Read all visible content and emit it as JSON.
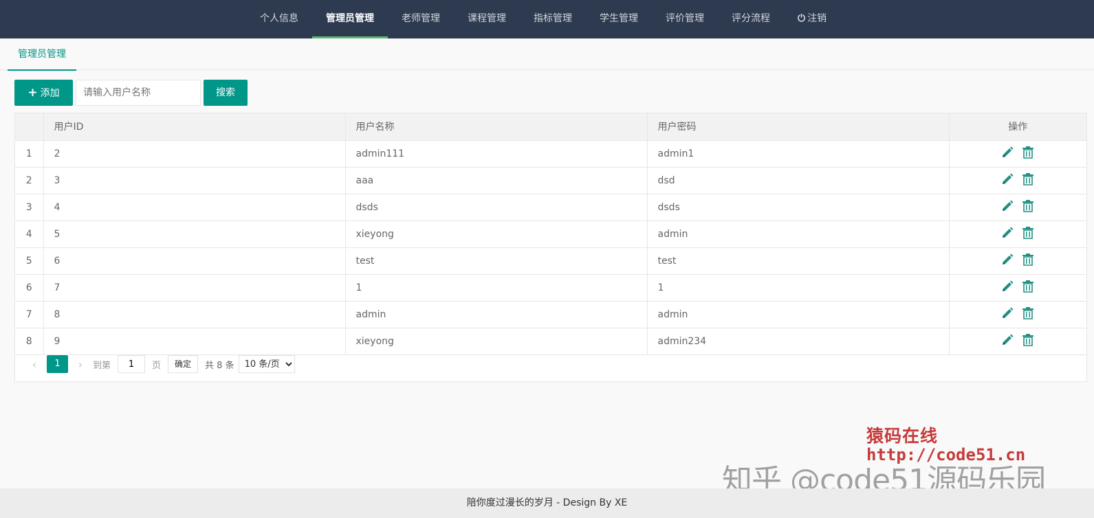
{
  "nav": {
    "items": [
      {
        "label": "个人信息",
        "active": false
      },
      {
        "label": "管理员管理",
        "active": true
      },
      {
        "label": "老师管理",
        "active": false
      },
      {
        "label": "课程管理",
        "active": false
      },
      {
        "label": "指标管理",
        "active": false
      },
      {
        "label": "学生管理",
        "active": false
      },
      {
        "label": "评价管理",
        "active": false
      },
      {
        "label": "评分流程",
        "active": false
      }
    ],
    "logout": {
      "icon": "power-icon",
      "label": "注销"
    }
  },
  "tab": {
    "label": "管理员管理"
  },
  "toolbar": {
    "add_label": "添加",
    "search_placeholder": "请输入用户名称",
    "search_value": "",
    "search_label": "搜索"
  },
  "table": {
    "columns": [
      "",
      "用户ID",
      "用户名称",
      "用户密码",
      "操作"
    ],
    "rows": [
      {
        "index": "1",
        "id": "2",
        "name": "admin111",
        "password": "admin1"
      },
      {
        "index": "2",
        "id": "3",
        "name": "aaa",
        "password": "dsd"
      },
      {
        "index": "3",
        "id": "4",
        "name": "dsds",
        "password": "dsds"
      },
      {
        "index": "4",
        "id": "5",
        "name": "xieyong",
        "password": "admin"
      },
      {
        "index": "5",
        "id": "6",
        "name": "test",
        "password": "test"
      },
      {
        "index": "6",
        "id": "7",
        "name": "1",
        "password": "1"
      },
      {
        "index": "7",
        "id": "8",
        "name": "admin",
        "password": "admin"
      },
      {
        "index": "8",
        "id": "9",
        "name": "xieyong",
        "password": "admin234"
      }
    ],
    "actions": [
      "edit-icon",
      "delete-icon"
    ]
  },
  "pager": {
    "prev": "‹",
    "current": "1",
    "next": "›",
    "goto_label": "到第",
    "goto_value": "1",
    "page_unit": "页",
    "confirm_label": "确定",
    "total_text": "共 8 条",
    "page_size": "10 条/页"
  },
  "watermark": {
    "line1": "猿码在线",
    "line2": "http://code51.cn",
    "line3": "知乎 @code51源码乐园"
  },
  "footer": {
    "text": "陪你度过漫长的岁月 - Design By XE"
  },
  "colors": {
    "nav_bg": "#2d3a4f",
    "accent": "#009688",
    "nav_active_underline": "#5fb878"
  }
}
